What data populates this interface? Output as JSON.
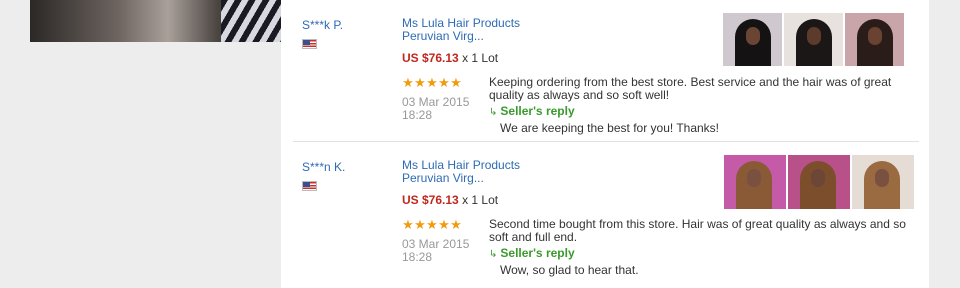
{
  "reviews": [
    {
      "buyer": "S***k P.",
      "flag_icon": "us-flag-icon",
      "product_line1": "Ms Lula Hair Products",
      "product_line2": "Peruvian Virg...",
      "price": "US $76.13",
      "quantity": "x 1 Lot",
      "rating": 5,
      "date_line1": "03 Mar 2015",
      "date_line2": "18:28",
      "comment": "Keeping ordering from the best store. Best service and the hair was of great quality as always and so soft well!",
      "reply_label": "Seller's reply",
      "reply_text": "We are keeping the best for you! Thanks!",
      "thumb_colors": [
        {
          "bg": "#cfc9cf",
          "hair": "#151214",
          "face": "#6b4533"
        },
        {
          "bg": "#e8e2df",
          "hair": "#1b1716",
          "face": "#5c3a2c"
        },
        {
          "bg": "#c9a4a8",
          "hair": "#2a1d19",
          "face": "#6a4232"
        }
      ]
    },
    {
      "buyer": "S***n K.",
      "flag_icon": "us-flag-icon",
      "product_line1": "Ms Lula Hair Products",
      "product_line2": "Peruvian Virg...",
      "price": "US $76.13",
      "quantity": "x 1 Lot",
      "rating": 5,
      "date_line1": "03 Mar 2015",
      "date_line2": "18:28",
      "comment": "Second time bought from this store. Hair was of great quality as always and so soft and full end.",
      "reply_label": "Seller's reply",
      "reply_text": "Wow, so glad to hear that.",
      "thumb_colors": [
        {
          "bg": "#c45aa8",
          "hair": "#8a5a36",
          "face": "#7a5040"
        },
        {
          "bg": "#b8508a",
          "hair": "#7d4e2c",
          "face": "#6c4636"
        },
        {
          "bg": "#e6dcd6",
          "hair": "#9a6a40",
          "face": "#7a5040"
        }
      ]
    }
  ],
  "colors": {
    "link_blue": "#2d6bb5",
    "price_red": "#c0281c",
    "reply_green": "#3a9a2e",
    "star_orange": "#f29b0e"
  }
}
